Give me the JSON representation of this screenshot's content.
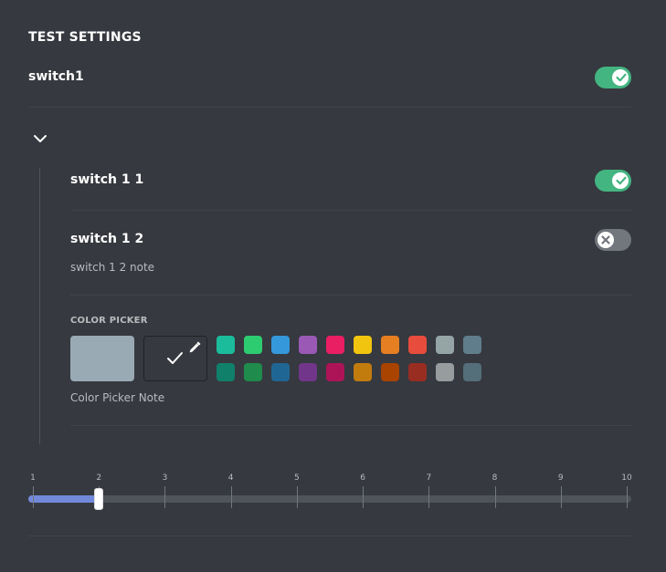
{
  "section": {
    "title": "TEST SETTINGS"
  },
  "switch1": {
    "label": "switch1",
    "checked": true
  },
  "group": {
    "expanded": true,
    "switch11": {
      "label": "switch 1 1",
      "checked": true
    },
    "switch12": {
      "label": "switch 1 2",
      "note": "switch 1 2 note",
      "checked": false
    },
    "color_picker": {
      "label": "COLOR PICKER",
      "note": "Color Picker Note",
      "default_color": "#99aab5",
      "swatches_row1": [
        "#1abc9c",
        "#2ecc71",
        "#3498db",
        "#9b59b6",
        "#e91e63",
        "#f1c40f",
        "#e67e22",
        "#e74c3c",
        "#95a5a6",
        "#607d8b"
      ],
      "swatches_row2": [
        "#11806a",
        "#1f8b4c",
        "#206694",
        "#71368a",
        "#ad1457",
        "#c27c0e",
        "#a84300",
        "#992d22",
        "#979c9f",
        "#546e7a"
      ]
    }
  },
  "slider": {
    "ticks": [
      "1",
      "2",
      "3",
      "4",
      "5",
      "6",
      "7",
      "8",
      "9",
      "10"
    ],
    "value": 2,
    "min": 1,
    "max": 10,
    "fill_color": "#7289da"
  },
  "icons": {
    "check": "check-icon",
    "close": "close-icon",
    "chevron": "chevron-down-icon",
    "eyedropper": "eyedropper-icon"
  },
  "colors": {
    "background": "#36393f",
    "switch_on": "#43b581",
    "switch_off": "#72767d",
    "accent": "#7289da"
  }
}
